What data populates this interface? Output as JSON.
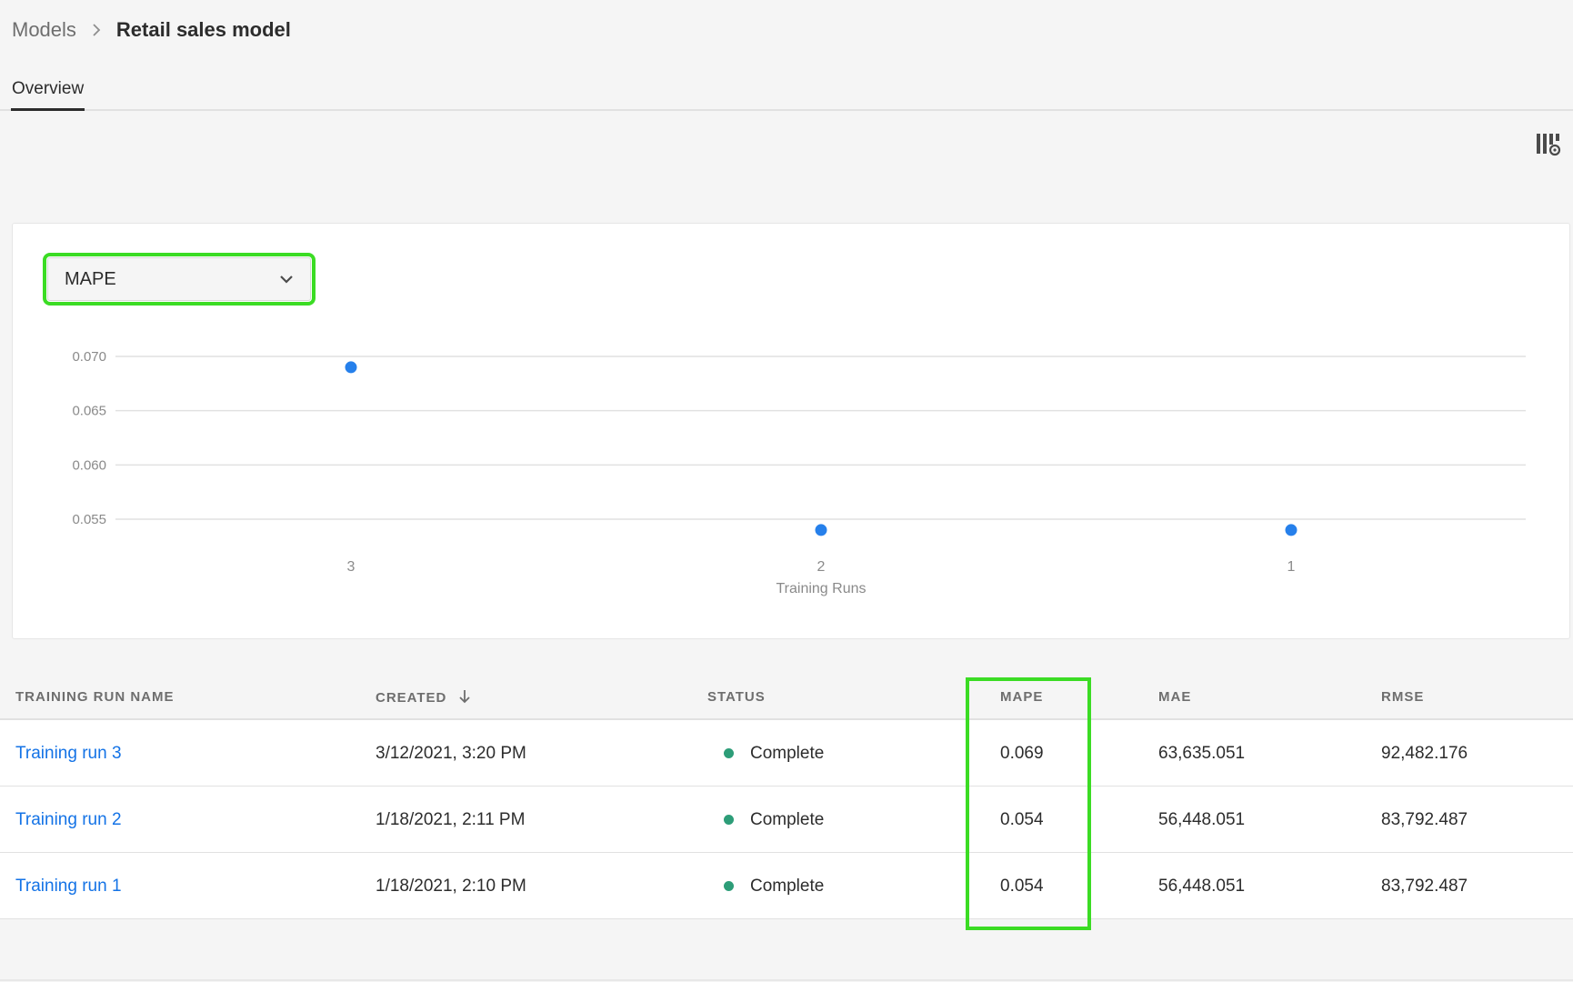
{
  "breadcrumb": {
    "parent": "Models",
    "current": "Retail sales model"
  },
  "tabs": [
    {
      "label": "Overview",
      "active": true
    }
  ],
  "toolbar": {
    "settings_icon": "column-settings-icon"
  },
  "metric_select": {
    "value": "MAPE"
  },
  "chart_data": {
    "type": "scatter",
    "x": [
      "3",
      "2",
      "1"
    ],
    "series": [
      {
        "values": [
          0.069,
          0.054,
          0.054
        ],
        "color": "#2680eb"
      }
    ],
    "xlabel": "Training Runs",
    "ylabel": "",
    "yticks": [
      "0.070",
      "0.065",
      "0.060",
      "0.055"
    ],
    "ytick_values": [
      0.07,
      0.065,
      0.06,
      0.055
    ],
    "ylim": [
      0.0535,
      0.0715
    ],
    "grid": true
  },
  "table": {
    "columns": [
      {
        "key": "name",
        "label": "TRAINING RUN NAME"
      },
      {
        "key": "created",
        "label": "CREATED",
        "sorted": "desc"
      },
      {
        "key": "status",
        "label": "STATUS"
      },
      {
        "key": "mape",
        "label": "MAPE"
      },
      {
        "key": "mae",
        "label": "MAE"
      },
      {
        "key": "rmse",
        "label": "RMSE"
      }
    ],
    "rows": [
      {
        "name": "Training run 3",
        "created": "3/12/2021, 3:20 PM",
        "status": "Complete",
        "mape": "0.069",
        "mae": "63,635.051",
        "rmse": "92,482.176"
      },
      {
        "name": "Training run 2",
        "created": "1/18/2021, 2:11 PM",
        "status": "Complete",
        "mape": "0.054",
        "mae": "56,448.051",
        "rmse": "83,792.487"
      },
      {
        "name": "Training run 1",
        "created": "1/18/2021, 2:10 PM",
        "status": "Complete",
        "mape": "0.054",
        "mae": "56,448.051",
        "rmse": "83,792.487"
      }
    ]
  },
  "colors": {
    "accent": "#1473e6",
    "status_complete": "#2d9d78",
    "highlight": "#3bdc24",
    "point": "#2680eb"
  }
}
